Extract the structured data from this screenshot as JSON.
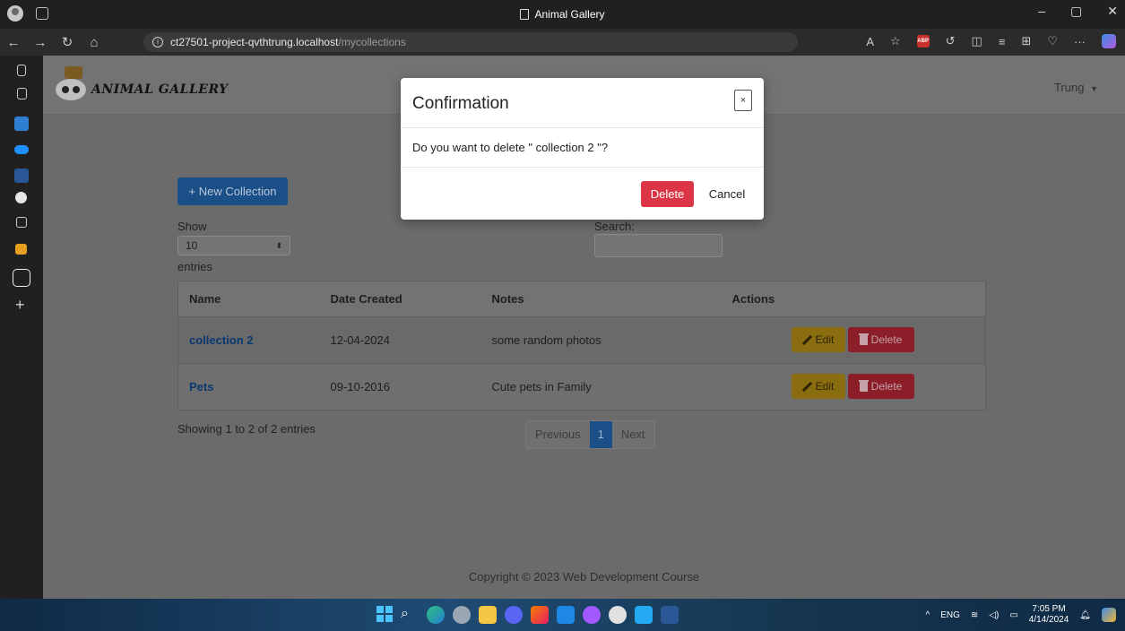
{
  "browser": {
    "window_title": "Animal Gallery",
    "url_host": "ct27501-project-qvthtrung.localhost",
    "url_path": "/mycollections"
  },
  "header": {
    "logo_text": "ANIMAL GALLERY",
    "user_name": "Trung"
  },
  "toolbar": {
    "new_collection_label": "+ New Collection",
    "show_label": "Show",
    "page_size": "10",
    "entries_label": "entries",
    "search_label": "Search:"
  },
  "table": {
    "columns": [
      "Name",
      "Date Created",
      "Notes",
      "Actions"
    ],
    "rows": [
      {
        "name": "collection 2",
        "date": "12-04-2024",
        "notes": "some random photos"
      },
      {
        "name": "Pets",
        "date": "09-10-2016",
        "notes": "Cute pets in Family"
      }
    ],
    "edit_label": "Edit",
    "delete_label": "Delete",
    "info": "Showing 1 to 2 of 2 entries",
    "pager": {
      "previous": "Previous",
      "current": "1",
      "next": "Next"
    }
  },
  "footer": {
    "copyright": "Copyright © 2023 Web Development Course"
  },
  "modal": {
    "title": "Confirmation",
    "close_label": "×",
    "message": "Do you want to delete \" collection 2 \"?",
    "delete_label": "Delete",
    "cancel_label": "Cancel"
  },
  "taskbar": {
    "language": "ENG",
    "time": "7:05 PM",
    "date": "4/14/2024"
  },
  "colors": {
    "primary": "#1b4f88",
    "danger": "#dc3545",
    "warning": "#8a6d10"
  }
}
